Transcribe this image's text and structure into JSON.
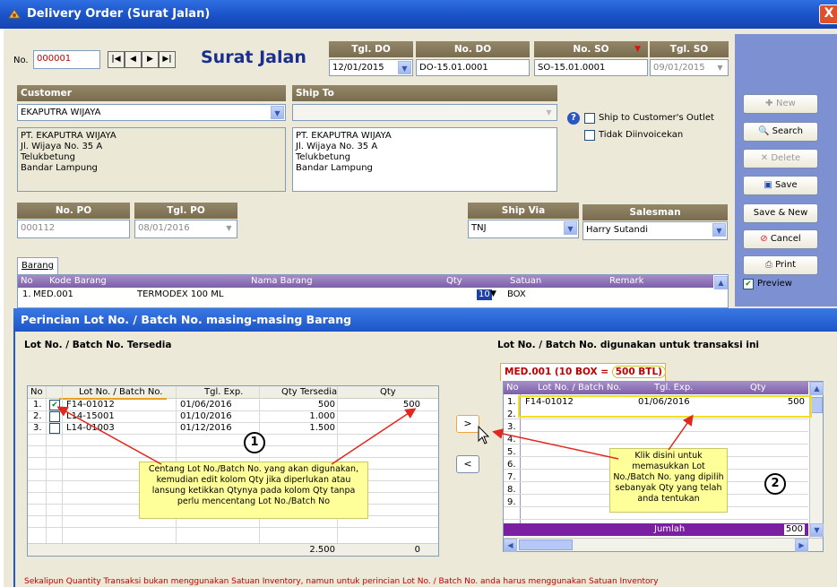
{
  "window": {
    "title": "Delivery Order (Surat Jalan)",
    "close_glyph": "X",
    "accent": "#1a52c8"
  },
  "header": {
    "no_label": "No.",
    "no_value": "000001",
    "nav": [
      "|◀",
      "◀",
      "▶",
      "▶|"
    ],
    "form_title": "Surat Jalan",
    "tgl_do_label": "Tgl. DO",
    "tgl_do_value": "12/01/2015",
    "no_do_label": "No. DO",
    "no_do_value": "DO-15.01.0001",
    "no_so_label": "No. SO",
    "no_so_value": "SO-15.01.0001",
    "tgl_so_label": "Tgl. SO",
    "tgl_so_value": "09/01/2015"
  },
  "customer": {
    "label": "Customer",
    "value": "EKAPUTRA WIJAYA",
    "address": "PT. EKAPUTRA WIJAYA\nJl. Wijaya No. 35 A\nTelukbetung\nBandar Lampung"
  },
  "ship_to": {
    "label": "Ship To",
    "value": "",
    "address": "PT. EKAPUTRA WIJAYA\nJl. Wijaya No. 35 A\nTelukbetung\nBandar Lampung",
    "ship_outlet_label": "Ship to Customer's Outlet",
    "tidak_label": "Tidak Diinvoicekan",
    "help_glyph": "?"
  },
  "po": {
    "no_po_label": "No. PO",
    "no_po_value": "000112",
    "tgl_po_label": "Tgl. PO",
    "tgl_po_value": "08/01/2016"
  },
  "ship_via": {
    "label": "Ship Via",
    "value": "TNJ"
  },
  "salesman": {
    "label": "Salesman",
    "value": "Harry Sutandi"
  },
  "side_buttons": {
    "new": "New",
    "search": "Search",
    "delete": "Delete",
    "save": "Save",
    "save_new": "Save & New",
    "cancel": "Cancel",
    "print": "Print",
    "preview": "Preview"
  },
  "barang_tab": {
    "label": "Barang"
  },
  "barang_grid": {
    "headers": [
      "No",
      "Kode Barang",
      "Nama Barang",
      "Qty",
      "Satuan",
      "Remark"
    ],
    "row": {
      "no": "1.",
      "kode": "MED.001",
      "nama": "TERMODEX 100 ML",
      "qty": "10",
      "satuan": "BOX",
      "remark": ""
    }
  },
  "popup": {
    "title": "Perincian Lot No. / Batch No. masing-masing Barang",
    "left_label": "Lot No. / Batch No. Tersedia",
    "right_label": "Lot No. / Batch No. digunakan untuk transaksi ini",
    "left_headers": [
      "No",
      "Lot No. / Batch No.",
      "Tgl. Exp.",
      "Qty Tersedia",
      "Qty"
    ],
    "left_rows": [
      {
        "no": "1.",
        "checked": "✔",
        "lot": "F14-01012",
        "exp": "01/06/2016",
        "tersedia": "500",
        "qty": "500"
      },
      {
        "no": "2.",
        "checked": "",
        "lot": "L14-15001",
        "exp": "01/10/2016",
        "tersedia": "1.000",
        "qty": ""
      },
      {
        "no": "3.",
        "checked": "",
        "lot": "L14-01003",
        "exp": "01/12/2016",
        "tersedia": "1.500",
        "qty": ""
      }
    ],
    "left_total_tersedia": "2.500",
    "left_total_qty": "0",
    "move_right": ">",
    "move_left": "<",
    "item_tab_prefix": "MED.001 (10 BOX = ",
    "item_tab_highlight": "500 BTL)",
    "right_headers": [
      "No",
      "Lot No. / Batch No.",
      "Tgl. Exp.",
      "Qty"
    ],
    "right_rows": [
      {
        "no": "1.",
        "lot": "F14-01012",
        "exp": "01/06/2016",
        "qty": "500"
      },
      {
        "no": "2.",
        "lot": "",
        "exp": "",
        "qty": ""
      },
      {
        "no": "3.",
        "lot": "",
        "exp": "",
        "qty": ""
      },
      {
        "no": "4.",
        "lot": "",
        "exp": "",
        "qty": ""
      },
      {
        "no": "5.",
        "lot": "",
        "exp": "",
        "qty": ""
      },
      {
        "no": "6.",
        "lot": "",
        "exp": "",
        "qty": ""
      },
      {
        "no": "7.",
        "lot": "",
        "exp": "",
        "qty": ""
      },
      {
        "no": "8.",
        "lot": "",
        "exp": "",
        "qty": ""
      },
      {
        "no": "9.",
        "lot": "",
        "exp": "",
        "qty": ""
      }
    ],
    "jumlah_label": "Jumlah",
    "jumlah_value": "500",
    "callout1": "Centang Lot No./Batch No. yang akan digunakan, kemudian edit kolom Qty jika diperlukan atau lansung ketikkan Qtynya pada kolom Qty tanpa perlu mencentang Lot No./Batch No",
    "callout2": "Klik disini untuk memasukkan Lot No./Batch No. yang dipilih sebanyak Qty yang telah anda tentukan",
    "marker1": "1",
    "marker2": "2",
    "footer_note": "Sekalipun Quantity Transaksi bukan menggunakan Satuan Inventory, namun untuk perincian Lot No. / Batch No. anda harus menggunakan Satuan Inventory"
  }
}
